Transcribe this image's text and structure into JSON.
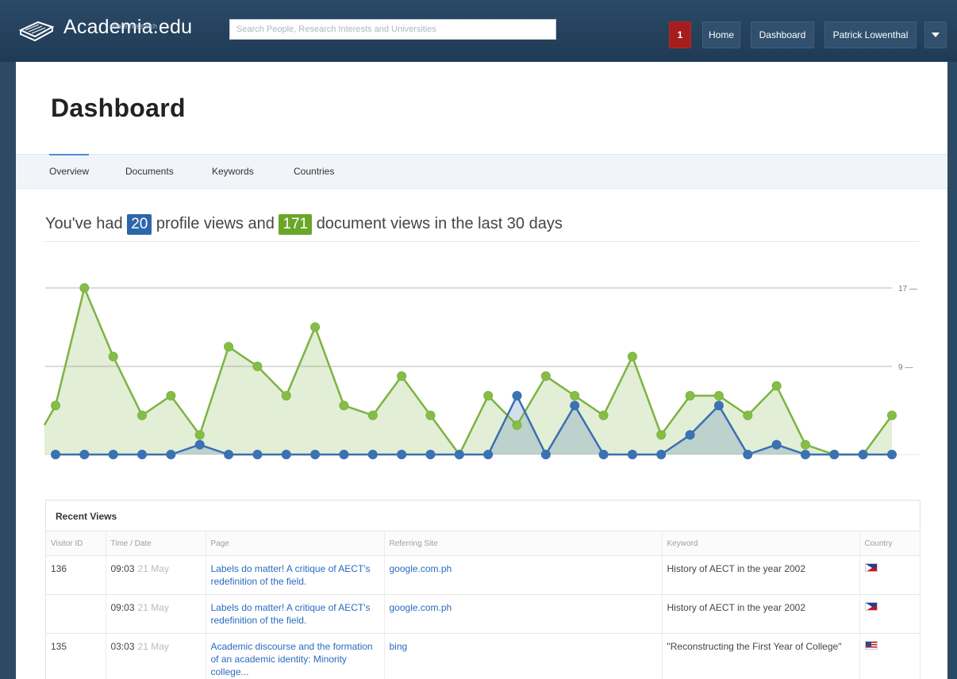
{
  "app": {
    "logo_text": "Academia.edu",
    "logo_tagline": "share research",
    "search_placeholder": "Search People, Research Interests and Universities"
  },
  "nav": {
    "notification_count": "1",
    "home": "Home",
    "dashboard": "Dashboard",
    "user": "Patrick Lowenthal"
  },
  "page": {
    "title": "Dashboard",
    "tabs": [
      "Overview",
      "Documents",
      "Keywords",
      "Countries"
    ],
    "active_tab": "Overview"
  },
  "summary": {
    "prefix": "You've had",
    "profile_views": "20",
    "middle": "profile views and",
    "document_views": "171",
    "suffix": "document views in the last 30 days"
  },
  "colors": {
    "profile_views": "#3a6fb0",
    "document_views": "#7cb342",
    "notification": "#a51d1d"
  },
  "chart_data": {
    "type": "area",
    "title": "",
    "xlabel": "",
    "ylabel": "",
    "ylim": [
      0,
      17
    ],
    "y_ticks": [
      9,
      17
    ],
    "grid": true,
    "series": [
      {
        "name": "document views",
        "values": [
          5,
          17,
          10,
          4,
          6,
          2,
          11,
          9,
          6,
          13,
          5,
          4,
          8,
          4,
          0,
          6,
          3,
          8,
          6,
          4,
          10,
          2,
          6,
          6,
          4,
          7,
          1,
          0,
          0,
          4
        ]
      },
      {
        "name": "profile views",
        "values": [
          0,
          0,
          0,
          0,
          0,
          1,
          0,
          0,
          0,
          0,
          0,
          0,
          0,
          0,
          0,
          0,
          6,
          0,
          5,
          0,
          0,
          0,
          2,
          5,
          0,
          1,
          0,
          0,
          0,
          0
        ]
      }
    ]
  },
  "recent_views": {
    "title": "Recent Views",
    "columns": [
      "Visitor ID",
      "Time / Date",
      "Page",
      "Referring Site",
      "Keyword",
      "Country"
    ],
    "rows": [
      {
        "visitor_id": "136",
        "time": "09:03",
        "date": "21 May",
        "page": "Labels do matter! A critique of AECT's redefinition of the field.",
        "referrer": "google.com.ph",
        "keyword": "History of AECT in the year 2002",
        "country_flag": "philippines-flag"
      },
      {
        "visitor_id": "",
        "time": "09:03",
        "date": "21 May",
        "page": "Labels do matter! A critique of AECT's redefinition of the field.",
        "referrer": "google.com.ph",
        "keyword": "History of AECT in the year 2002",
        "country_flag": "philippines-flag"
      },
      {
        "visitor_id": "135",
        "time": "03:03",
        "date": "21 May",
        "page": "Academic discourse and the formation of an academic identity: Minority college...",
        "referrer": "bing",
        "keyword": "\"Reconstructing the First Year of College\"",
        "country_flag": "usa-flag"
      }
    ]
  }
}
